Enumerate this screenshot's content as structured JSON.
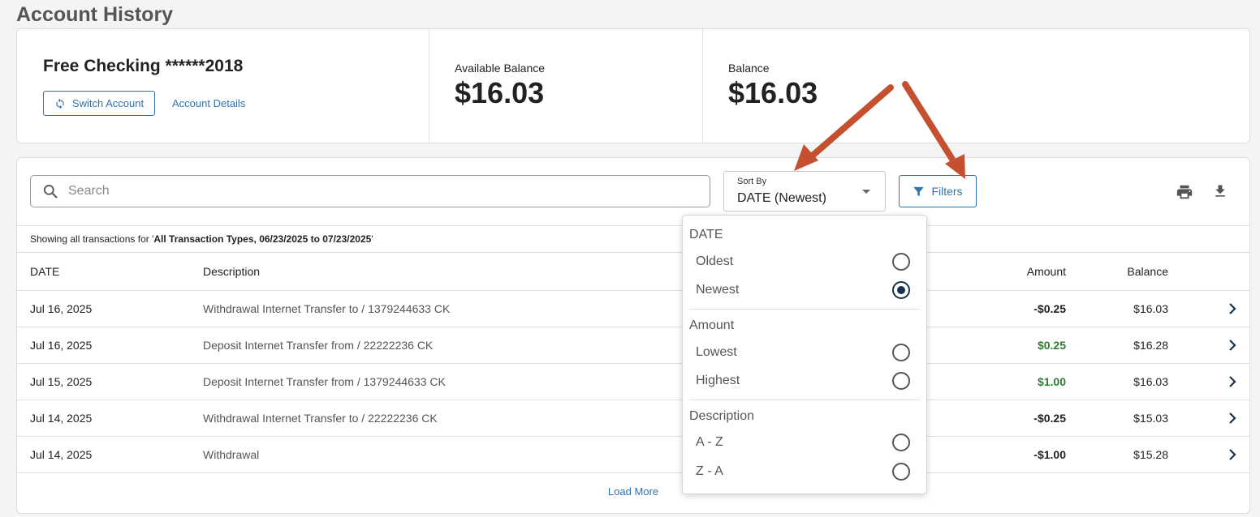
{
  "page": {
    "title": "Account History"
  },
  "account": {
    "name": "Free Checking ******2018",
    "switch_label": "Switch Account",
    "details_label": "Account Details",
    "available_balance_label": "Available Balance",
    "available_balance": "$16.03",
    "balance_label": "Balance",
    "balance": "$16.03"
  },
  "toolbar": {
    "search_placeholder": "Search",
    "sort_label": "Sort By",
    "sort_value": "DATE (Newest)",
    "filters_label": "Filters",
    "icons": [
      "search-icon",
      "caret-down-icon",
      "filter-icon",
      "print-icon",
      "download-icon"
    ]
  },
  "summary": {
    "prefix": "Showing all transactions for '",
    "criteria": "All Transaction Types, 06/23/2025 to 07/23/2025",
    "suffix": "'"
  },
  "table": {
    "headers": {
      "date": "DATE",
      "description": "Description",
      "amount": "Amount",
      "balance": "Balance"
    },
    "rows": [
      {
        "date": "Jul 16, 2025",
        "description": "Withdrawal Internet Transfer to / 1379244633 CK",
        "amount": "-$0.25",
        "balance": "$16.03"
      },
      {
        "date": "Jul 16, 2025",
        "description": "Deposit Internet Transfer from / 22222236 CK",
        "amount": "$0.25",
        "balance": "$16.28"
      },
      {
        "date": "Jul 15, 2025",
        "description": "Deposit Internet Transfer from / 1379244633 CK",
        "amount": "$1.00",
        "balance": "$16.03"
      },
      {
        "date": "Jul 14, 2025",
        "description": "Withdrawal Internet Transfer to / 22222236 CK",
        "amount": "-$0.25",
        "balance": "$15.03"
      },
      {
        "date": "Jul 14, 2025",
        "description": "Withdrawal",
        "amount": "-$1.00",
        "balance": "$15.28"
      }
    ],
    "load_more": "Load More"
  },
  "sort_menu": {
    "groups": [
      {
        "title": "DATE",
        "options": [
          {
            "label": "Oldest",
            "selected": false
          },
          {
            "label": "Newest",
            "selected": true
          }
        ]
      },
      {
        "title": "Amount",
        "options": [
          {
            "label": "Lowest",
            "selected": false
          },
          {
            "label": "Highest",
            "selected": false
          }
        ]
      },
      {
        "title": "Description",
        "options": [
          {
            "label": "A - Z",
            "selected": false
          },
          {
            "label": "Z - A",
            "selected": false
          }
        ]
      }
    ]
  },
  "colors": {
    "link": "#2f72ad",
    "positive_amount": "#2e7d32",
    "radio_selected": "#17324d",
    "annotation_arrow": "#c4502f"
  }
}
